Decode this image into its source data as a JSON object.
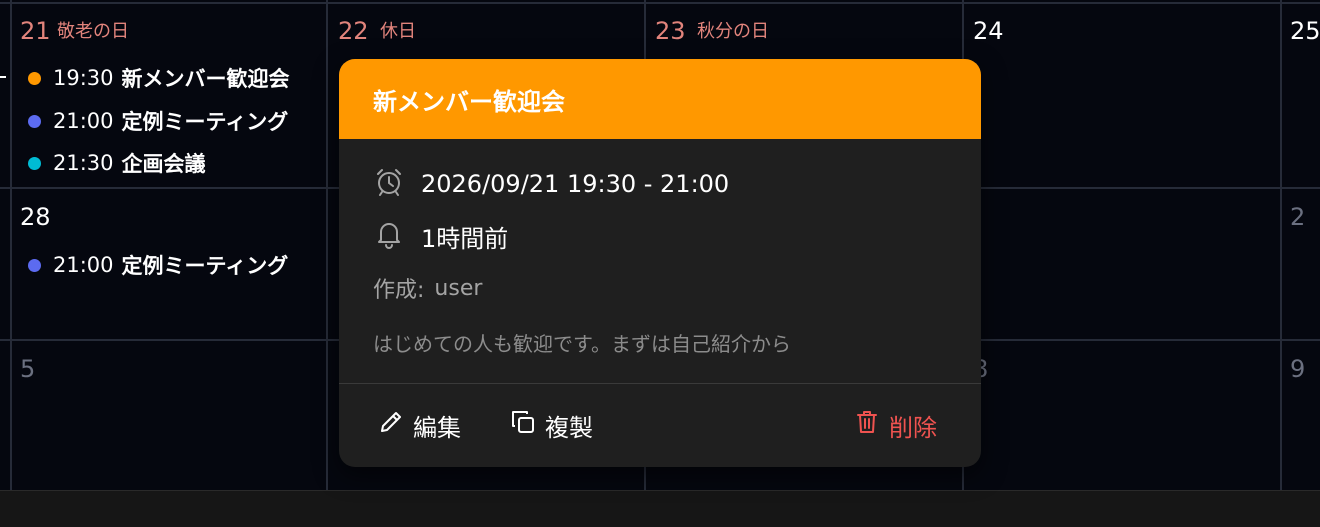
{
  "calendar": {
    "weeks": [
      {
        "days": [
          {
            "num": "21",
            "holiday": "敬老の日"
          },
          {
            "num": "22",
            "holiday": "休日"
          },
          {
            "num": "23",
            "holiday": "秋分の日"
          },
          {
            "num": "24",
            "holiday": ""
          },
          {
            "num": "25",
            "holiday": ""
          }
        ]
      },
      {
        "days": [
          {
            "num": "28"
          },
          {
            "num": "2"
          }
        ]
      },
      {
        "days": [
          {
            "num": "5"
          },
          {
            "num": "6"
          },
          {
            "num": "8"
          },
          {
            "num": "9"
          }
        ]
      }
    ],
    "events_day21": [
      {
        "time": "19:30",
        "title": "新メンバー歓迎会",
        "color": "#ff9800"
      },
      {
        "time": "21:00",
        "title": "定例ミーティング",
        "color": "#5c6bf0"
      },
      {
        "time": "21:30",
        "title": "企画会議",
        "color": "#00bcd4"
      }
    ],
    "events_day28": [
      {
        "time": "21:00",
        "title": "定例ミーティング",
        "color": "#5c6bf0"
      }
    ]
  },
  "popover": {
    "title": "新メンバー歓迎会",
    "header_color": "#ff9800",
    "datetime": "2026/09/21 19:30 - 21:00",
    "reminder": "1時間前",
    "creator_label": "作成:",
    "creator": "user",
    "description": "はじめての人も歓迎です。まずは自己紹介から",
    "actions": {
      "edit": "編集",
      "duplicate": "複製",
      "delete": "削除"
    }
  }
}
